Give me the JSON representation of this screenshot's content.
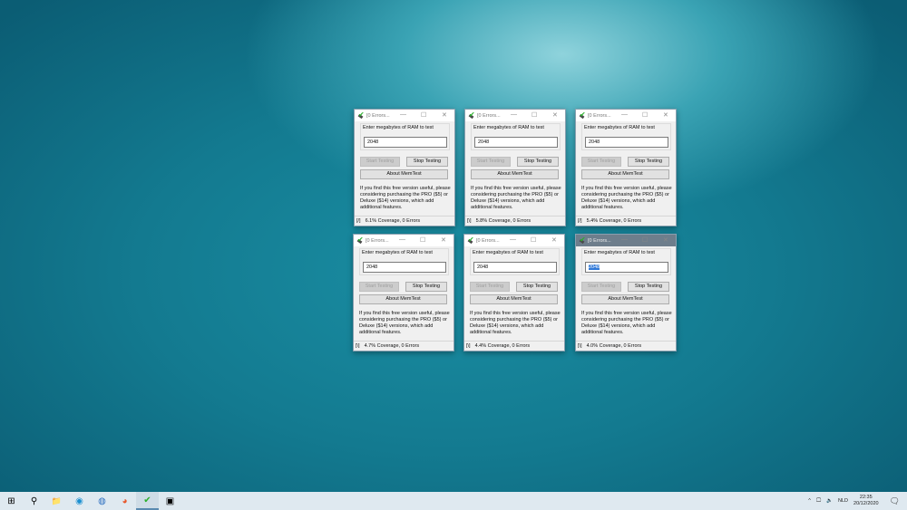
{
  "window_common": {
    "title": "[0 Errors...",
    "prompt": "Enter megabytes of RAM to test",
    "start_label": "Start Testing",
    "stop_label": "Stop Testing",
    "about_label": "About MemTest",
    "info_text": "If you find this free version useful, please considering purchasing the PRO ($5) or Deluxe ($14) versions, which add additional features."
  },
  "windows": [
    {
      "ram": "2048",
      "spinner": "[/]",
      "status": "6.1% Coverage, 0 Errors",
      "active": false
    },
    {
      "ram": "2048",
      "spinner": "[\\]",
      "status": "5.8% Coverage, 0 Errors",
      "active": false
    },
    {
      "ram": "2048",
      "spinner": "[/]",
      "status": "5.4% Coverage, 0 Errors",
      "active": false
    },
    {
      "ram": "2048",
      "spinner": "[\\]",
      "status": "4.7% Coverage, 0 Errors",
      "active": false
    },
    {
      "ram": "2048",
      "spinner": "[\\]",
      "status": "4.4% Coverage, 0 Errors",
      "active": false
    },
    {
      "ram": "2048",
      "spinner": "[\\]",
      "status": "4.0% Coverage, 0 Errors",
      "active": true
    }
  ],
  "taskbar": {
    "items": [
      {
        "name": "start-icon",
        "glyph": "⊞"
      },
      {
        "name": "search-icon",
        "glyph": "⚲"
      },
      {
        "name": "file-explorer-icon",
        "glyph": "📁"
      },
      {
        "name": "edge-icon",
        "glyph": "◉"
      },
      {
        "name": "thunderbird-icon",
        "glyph": "◍"
      },
      {
        "name": "firefox-icon",
        "glyph": "◕"
      },
      {
        "name": "memtest-icon",
        "glyph": "✔"
      },
      {
        "name": "network-app-icon",
        "glyph": "▣"
      }
    ],
    "language": "NLD",
    "time": "22:35",
    "date": "20/12/2020"
  }
}
